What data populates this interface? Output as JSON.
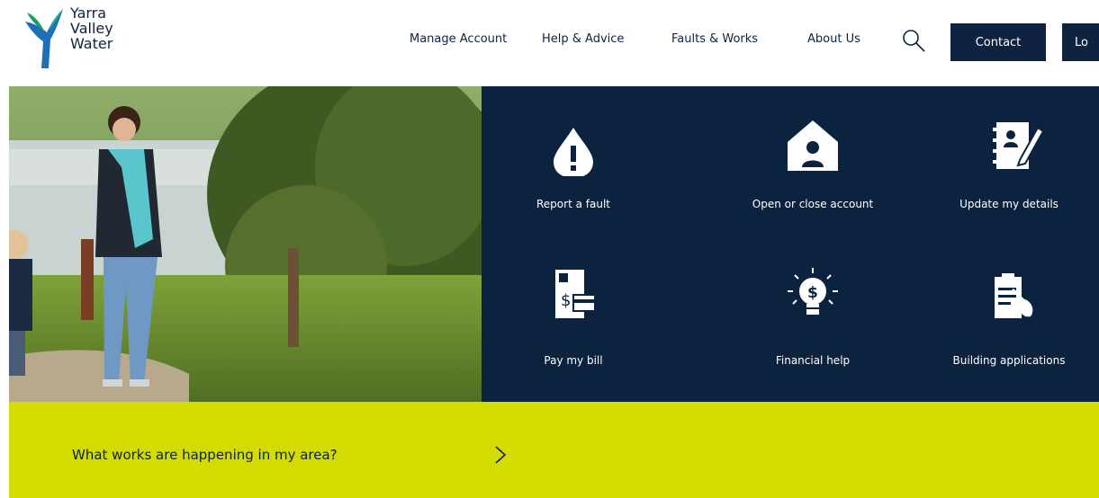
{
  "header": {
    "logo": {
      "line1": "Yarra",
      "line2": "Valley",
      "line3": "Water"
    },
    "nav": [
      {
        "label": "Manage Account"
      },
      {
        "label": "Help & Advice"
      },
      {
        "label": "Faults & Works"
      },
      {
        "label": "About Us"
      }
    ],
    "search_icon": "search-icon",
    "contact_label": "Contact",
    "login_label": "Lo"
  },
  "tiles": [
    {
      "label": "Report a fault",
      "icon": "water-drop-alert-icon"
    },
    {
      "label": "Open or close account",
      "icon": "house-person-icon"
    },
    {
      "label": "Update my details",
      "icon": "notebook-pen-icon"
    },
    {
      "label": "Pay my bill",
      "icon": "bill-card-icon"
    },
    {
      "label": "Financial help",
      "icon": "lightbulb-dollar-icon"
    },
    {
      "label": "Building applications",
      "icon": "clipboard-shovel-icon"
    }
  ],
  "banner": {
    "text": "What works are happening in my area?",
    "arrow_icon": "chevron-right-icon"
  },
  "colors": {
    "navy": "#0c2340",
    "lime": "#d4db00",
    "logo_green": "#1a9e6e",
    "logo_blue": "#1f6fb8"
  }
}
